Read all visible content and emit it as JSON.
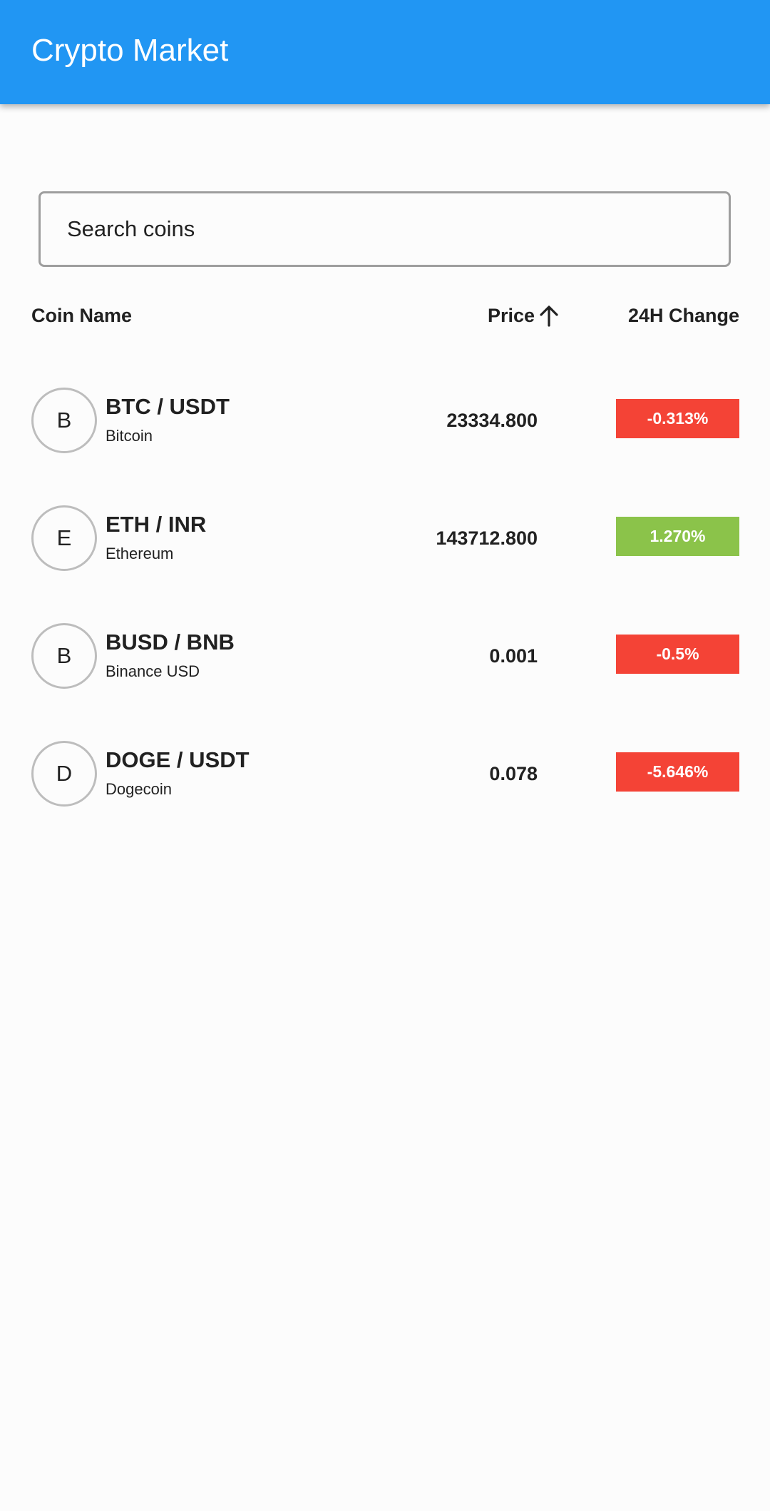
{
  "app_bar": {
    "title": "Crypto Market",
    "color": "#2196f3"
  },
  "search": {
    "placeholder": "Search coins",
    "value": ""
  },
  "table_header": {
    "coin_name": "Coin Name",
    "price": "Price",
    "price_sort_icon": "arrow-up-icon",
    "change": "24H Change"
  },
  "colors": {
    "positive": "#8bc34a",
    "negative": "#f44336"
  },
  "coins": [
    {
      "initial": "B",
      "pair": "BTC / USDT",
      "name": "Bitcoin",
      "price": "23334.800",
      "change": "-0.313%",
      "trend": "negative"
    },
    {
      "initial": "E",
      "pair": "ETH / INR",
      "name": "Ethereum",
      "price": "143712.800",
      "change": "1.270%",
      "trend": "positive"
    },
    {
      "initial": "B",
      "pair": "BUSD / BNB",
      "name": "Binance USD",
      "price": "0.001",
      "change": "-0.5%",
      "trend": "negative"
    },
    {
      "initial": "D",
      "pair": "DOGE / USDT",
      "name": "Dogecoin",
      "price": "0.078",
      "change": "-5.646%",
      "trend": "negative"
    }
  ]
}
